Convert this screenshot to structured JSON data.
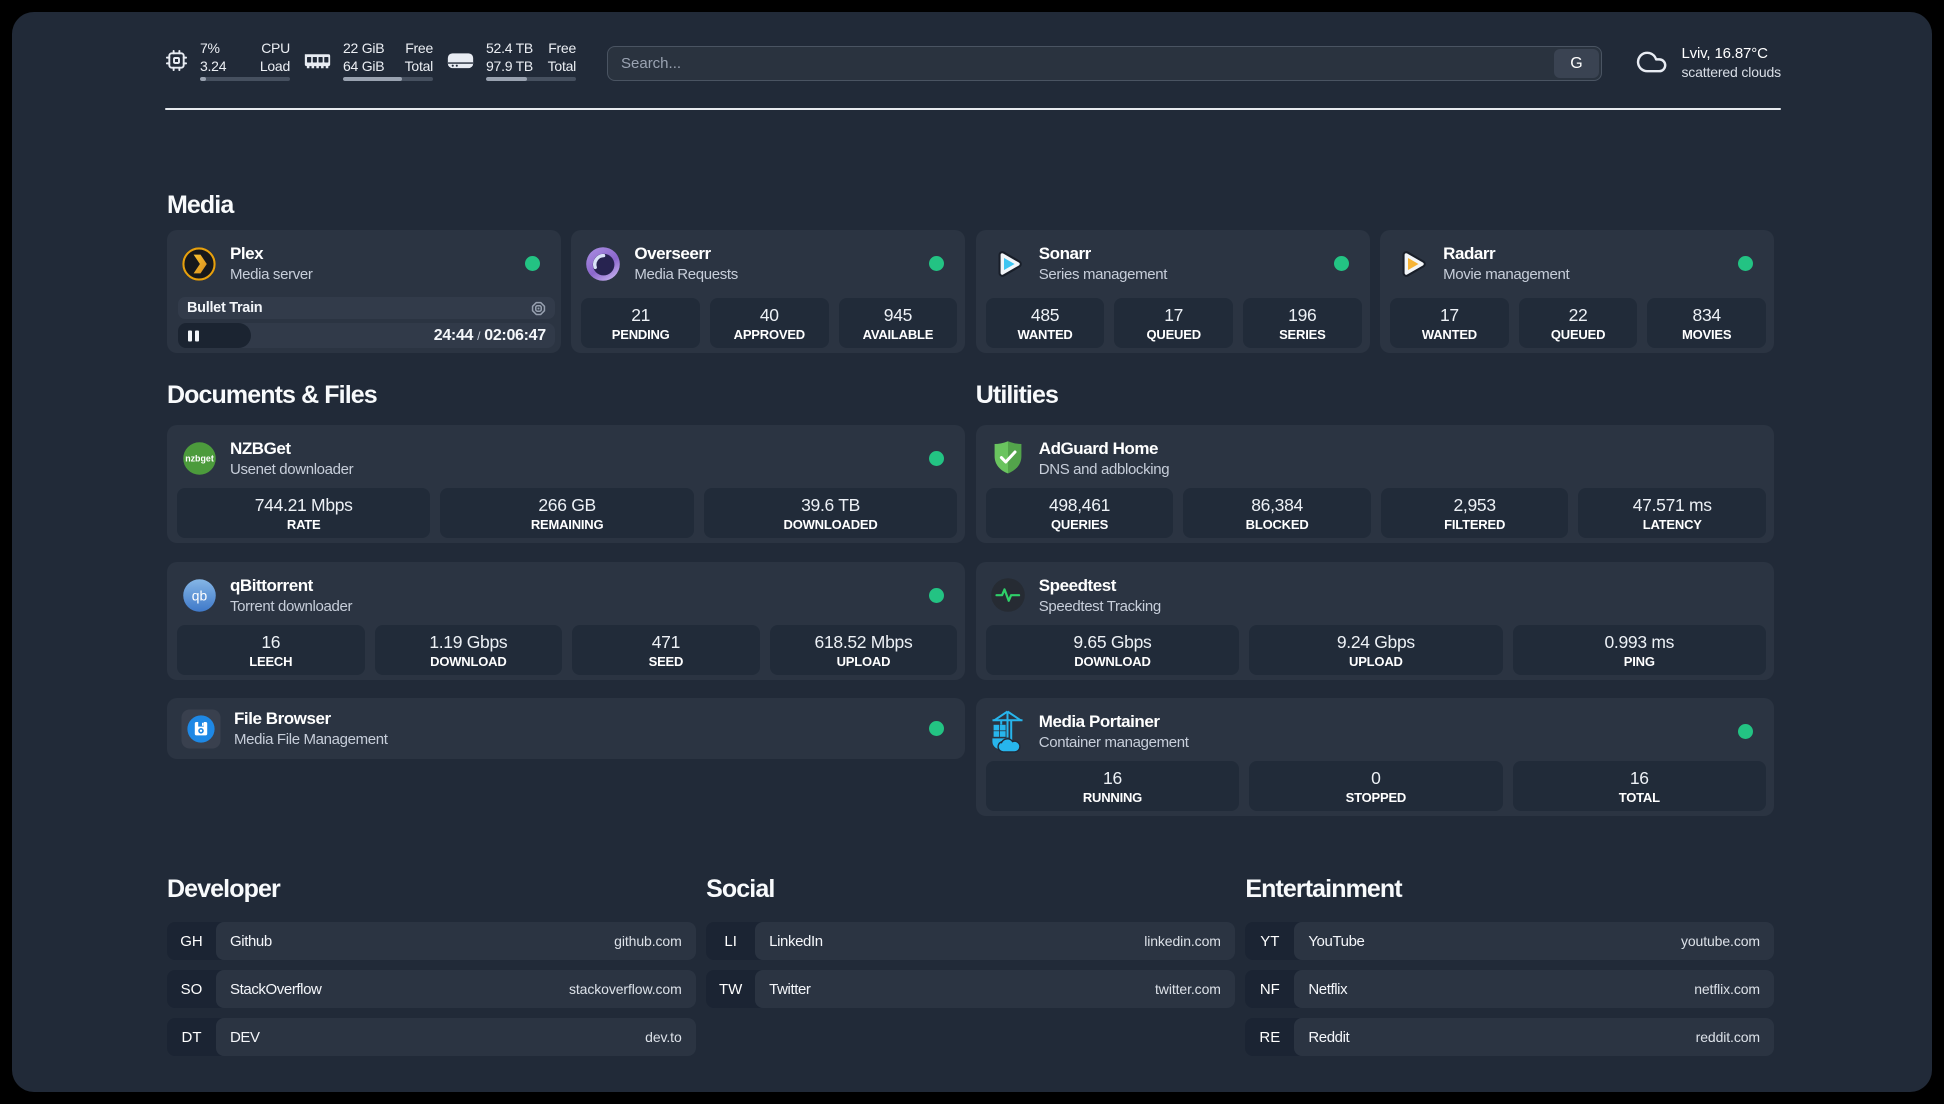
{
  "colors": {
    "status_online": "#23C383",
    "panel_bg": "#212A38",
    "card_bg": "#2B3442"
  },
  "topbar": {
    "resources": [
      {
        "icon": "cpu-icon",
        "values": [
          "7%",
          "3.24"
        ],
        "labels": [
          "CPU",
          "Load"
        ],
        "progress_percent": 7
      },
      {
        "icon": "memory-icon",
        "values": [
          "22 GiB",
          "64 GiB"
        ],
        "labels": [
          "Free",
          "Total"
        ],
        "progress_percent": 66
      },
      {
        "icon": "disk-icon",
        "values": [
          "52.4 TB",
          "97.9 TB"
        ],
        "labels": [
          "Free",
          "Total"
        ],
        "progress_percent": 46
      }
    ],
    "search": {
      "placeholder": "Search...",
      "provider_button": "G"
    },
    "weather": {
      "location": "Lviv, 16.87°C",
      "condition": "scattered clouds"
    }
  },
  "media": {
    "title": "Media",
    "plex": {
      "name": "Plex",
      "description": "Media server",
      "status": "online",
      "now_playing": {
        "title": "Bullet Train",
        "elapsed": "24:44",
        "separator": "/",
        "duration": "02:06:47",
        "progress_percent": 19.5
      }
    },
    "overseerr": {
      "name": "Overseerr",
      "description": "Media Requests",
      "status": "online",
      "stats": [
        {
          "value": "21",
          "label": "PENDING"
        },
        {
          "value": "40",
          "label": "APPROVED"
        },
        {
          "value": "945",
          "label": "AVAILABLE"
        }
      ]
    },
    "sonarr": {
      "name": "Sonarr",
      "description": "Series management",
      "status": "online",
      "stats": [
        {
          "value": "485",
          "label": "WANTED"
        },
        {
          "value": "17",
          "label": "QUEUED"
        },
        {
          "value": "196",
          "label": "SERIES"
        }
      ]
    },
    "radarr": {
      "name": "Radarr",
      "description": "Movie management",
      "status": "online",
      "stats": [
        {
          "value": "17",
          "label": "WANTED"
        },
        {
          "value": "22",
          "label": "QUEUED"
        },
        {
          "value": "834",
          "label": "MOVIES"
        }
      ]
    }
  },
  "documents": {
    "title": "Documents & Files",
    "nzbget": {
      "name": "NZBGet",
      "description": "Usenet downloader",
      "status": "online",
      "stats": [
        {
          "value": "744.21 Mbps",
          "label": "RATE"
        },
        {
          "value": "266 GB",
          "label": "REMAINING"
        },
        {
          "value": "39.6 TB",
          "label": "DOWNLOADED"
        }
      ]
    },
    "qbittorrent": {
      "name": "qBittorrent",
      "description": "Torrent downloader",
      "status": "online",
      "stats": [
        {
          "value": "16",
          "label": "LEECH"
        },
        {
          "value": "1.19 Gbps",
          "label": "DOWNLOAD"
        },
        {
          "value": "471",
          "label": "SEED"
        },
        {
          "value": "618.52 Mbps",
          "label": "UPLOAD"
        }
      ]
    },
    "filebrowser": {
      "name": "File Browser",
      "description": "Media File Management",
      "status": "online"
    }
  },
  "utilities": {
    "title": "Utilities",
    "adguard": {
      "name": "AdGuard Home",
      "description": "DNS and adblocking",
      "stats": [
        {
          "value": "498,461",
          "label": "QUERIES"
        },
        {
          "value": "86,384",
          "label": "BLOCKED"
        },
        {
          "value": "2,953",
          "label": "FILTERED"
        },
        {
          "value": "47.571 ms",
          "label": "LATENCY"
        }
      ]
    },
    "speedtest": {
      "name": "Speedtest",
      "description": "Speedtest Tracking",
      "stats": [
        {
          "value": "9.65 Gbps",
          "label": "DOWNLOAD"
        },
        {
          "value": "9.24 Gbps",
          "label": "UPLOAD"
        },
        {
          "value": "0.993 ms",
          "label": "PING"
        }
      ]
    },
    "portainer": {
      "name": "Media Portainer",
      "description": "Container management",
      "status": "online",
      "stats": [
        {
          "value": "16",
          "label": "RUNNING"
        },
        {
          "value": "0",
          "label": "STOPPED"
        },
        {
          "value": "16",
          "label": "TOTAL"
        }
      ]
    }
  },
  "bookmarks": [
    {
      "title": "Developer",
      "links": [
        {
          "abbr": "GH",
          "name": "Github",
          "url": "github.com"
        },
        {
          "abbr": "SO",
          "name": "StackOverflow",
          "url": "stackoverflow.com"
        },
        {
          "abbr": "DT",
          "name": "DEV",
          "url": "dev.to"
        }
      ]
    },
    {
      "title": "Social",
      "links": [
        {
          "abbr": "LI",
          "name": "LinkedIn",
          "url": "linkedin.com"
        },
        {
          "abbr": "TW",
          "name": "Twitter",
          "url": "twitter.com"
        }
      ]
    },
    {
      "title": "Entertainment",
      "links": [
        {
          "abbr": "YT",
          "name": "YouTube",
          "url": "youtube.com"
        },
        {
          "abbr": "NF",
          "name": "Netflix",
          "url": "netflix.com"
        },
        {
          "abbr": "RE",
          "name": "Reddit",
          "url": "reddit.com"
        }
      ]
    }
  ]
}
